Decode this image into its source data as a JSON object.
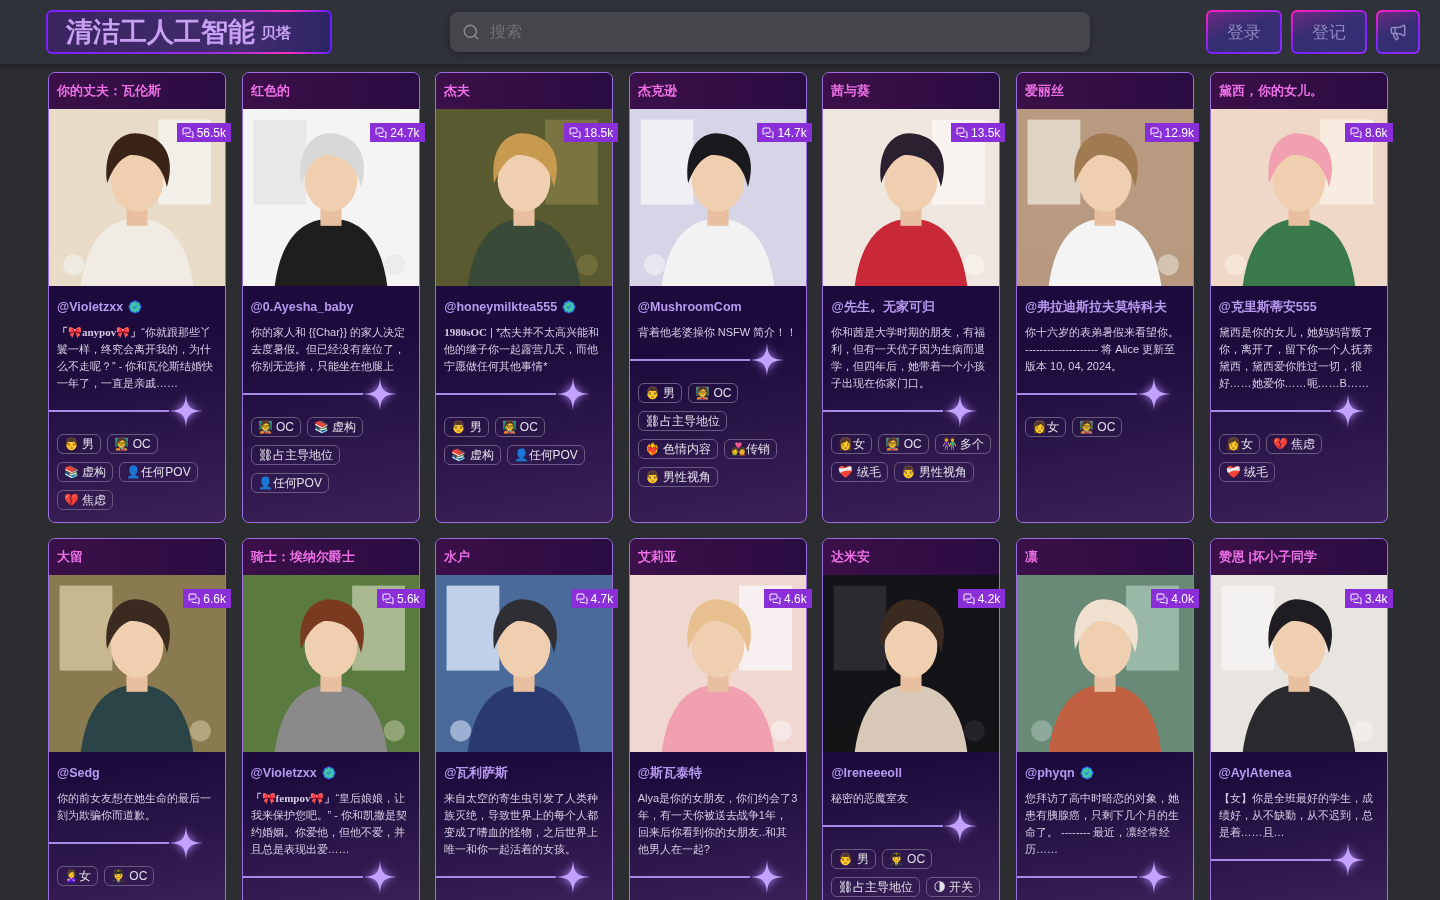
{
  "header": {
    "logo": {
      "title": "清洁工人工智能",
      "badge": "贝塔"
    },
    "search": {
      "placeholder": "搜索"
    },
    "buttons": [
      {
        "kind": "text",
        "label": "登录"
      },
      {
        "kind": "text",
        "label": "登记"
      },
      {
        "kind": "announce"
      }
    ]
  },
  "cards": [
    {
      "title": "你的丈夫：瓦伦斯",
      "count": "56.5k",
      "picture": {
        "kind": "picture"
      },
      "author": "@Violetzxx",
      "verified": true,
      "lead": "「🎀anypov🎀」",
      "text": "“你就跟那些丫鬟一样，终究会离开我的，为什么不走呢？” - 你和瓦伦斯结婚快一年了，一直是亲戚……",
      "tags": [
        "👨 男",
        "🧑‍🏫 OC",
        "📚 虚构",
        "👤任何POV",
        "💔 焦虑"
      ]
    },
    {
      "title": "红色的",
      "count": "24.7k",
      "picture": {
        "kind": "picture"
      },
      "author": "@0.Ayesha_baby",
      "verified": false,
      "text": "你的家人和 {{Char}} 的家人决定去度暑假。但已经没有座位了，你别无选择，只能坐在他腿上",
      "tags": [
        "🧑‍🏫 OC",
        "📚 虚构",
        "⛓占主导地位",
        "👤任何POV"
      ]
    },
    {
      "title": "杰夫",
      "count": "18.5k",
      "picture": {
        "kind": "picture"
      },
      "author": "@honeymilktea555",
      "verified": true,
      "lead": "1980sOC",
      "text": " | *杰夫并不太高兴能和他的继子你一起露营几天，而他宁愿做任何其他事情*",
      "tags": [
        "👨 男",
        "🧑‍🏫 OC",
        "📚 虚构",
        "👤任何POV"
      ]
    },
    {
      "title": "杰克逊",
      "count": "14.7k",
      "picture": {
        "kind": "picture"
      },
      "author": "@MushroomCom",
      "verified": false,
      "text": "背着他老婆操你 NSFW 简介！！",
      "tags": [
        "👨 男",
        "🧑‍🏫 OC",
        "⛓占主导地位",
        "❤️‍🔥 色情内容",
        "💑传销",
        "👨 男性视角"
      ]
    },
    {
      "title": "茜与葵",
      "count": "13.5k",
      "picture": {
        "kind": "picture"
      },
      "author": "@先生。无家可归",
      "verified": false,
      "text": "你和茜是大学时期的朋友，有福利，但有一天优子因为生病而退学，但四年后，她带着一个小孩子出现在你家门口。",
      "tags": [
        "👩女",
        "🧑‍🏫 OC",
        "👫 多个",
        "❤️‍🩹 绒毛",
        "👨 男性视角"
      ]
    },
    {
      "title": "爱丽丝",
      "count": "12.9k",
      "picture": {
        "kind": "picture"
      },
      "author": "@弗拉迪斯拉夫莫特科夫",
      "verified": false,
      "text": "你十六岁的表弟暑假来看望你。 -------------------- 将 Alice 更新至版本 10, 04, 2024。",
      "tags": [
        "👩女",
        "🧑‍🏫 OC"
      ]
    },
    {
      "title": "黛西，你的女儿。",
      "count": "8.6k",
      "picture": {
        "kind": "picture"
      },
      "author": "@克里斯蒂安555",
      "verified": false,
      "text": "黛西是你的女儿，她妈妈背叛了你，离开了，留下你一个人抚养黛西，黛西爱你胜过一切，很好……她爱你……呃……B……",
      "tags": [
        "👩女",
        "💔 焦虑",
        "❤️‍🩹 绒毛"
      ]
    },
    {
      "title": "大留",
      "count": "6.6k",
      "picture": {
        "kind": "picture"
      },
      "author": "@Sedg",
      "verified": false,
      "text": "你的前女友想在她生命的最后一刻为欺骗你而道歉。",
      "tags": [
        "🙎‍♀️女",
        "🧑‍✈️ OC"
      ]
    },
    {
      "title": "骑士：埃纳尔爵士",
      "count": "5.6k",
      "picture": {
        "kind": "picture"
      },
      "author": "@Violetzxx",
      "verified": true,
      "lead": "「🎀fempov🎀」",
      "text": "“皇后娘娘，让我来保护您吧。” - 你和凯撒是契约婚姻。你爱他，但他不爱，并且总是表现出爱……"
    },
    {
      "title": "水户",
      "count": "4.7k",
      "picture": {
        "kind": "picture"
      },
      "author": "@瓦利萨斯",
      "verified": false,
      "text": "来自太空的寄生虫引发了人类种族灭绝，导致世界上的每个人都变成了嗜血的怪物，之后世界上唯一和你一起活着的女孩。"
    },
    {
      "title": "艾莉亚",
      "count": "4.6k",
      "picture": {
        "kind": "picture"
      },
      "author": "@斯瓦泰特",
      "verified": false,
      "text": "Alya是你的女朋友，你们约会了3年，有一天你被送去战争1年，回来后你看到你的女朋友..和其他男人在一起?"
    },
    {
      "title": "达米安",
      "count": "4.2k",
      "picture": {
        "kind": "picture"
      },
      "author": "@Ireneeeoll",
      "verified": false,
      "text": "秘密的恶魔室友",
      "tags": [
        "👨 男",
        "🧑‍✈️ OC",
        "⛓占主导地位",
        "🌗 开关"
      ]
    },
    {
      "title": "凛",
      "count": "4.0k",
      "picture": {
        "kind": "picture"
      },
      "author": "@phyqn",
      "verified": true,
      "text": "您拜访了高中时暗恋的对象，她患有胰腺癌，只剩下几个月的生命了。 -------- 最近，凛经常经历……"
    },
    {
      "title": "赞恩 |坏小子同学",
      "count": "3.4k",
      "picture": {
        "kind": "picture"
      },
      "author": "@AylAtenea",
      "verified": false,
      "text": "【女】你是全班最好的学生，成绩好，从不缺勤，从不迟到，总是着……且…"
    }
  ]
}
